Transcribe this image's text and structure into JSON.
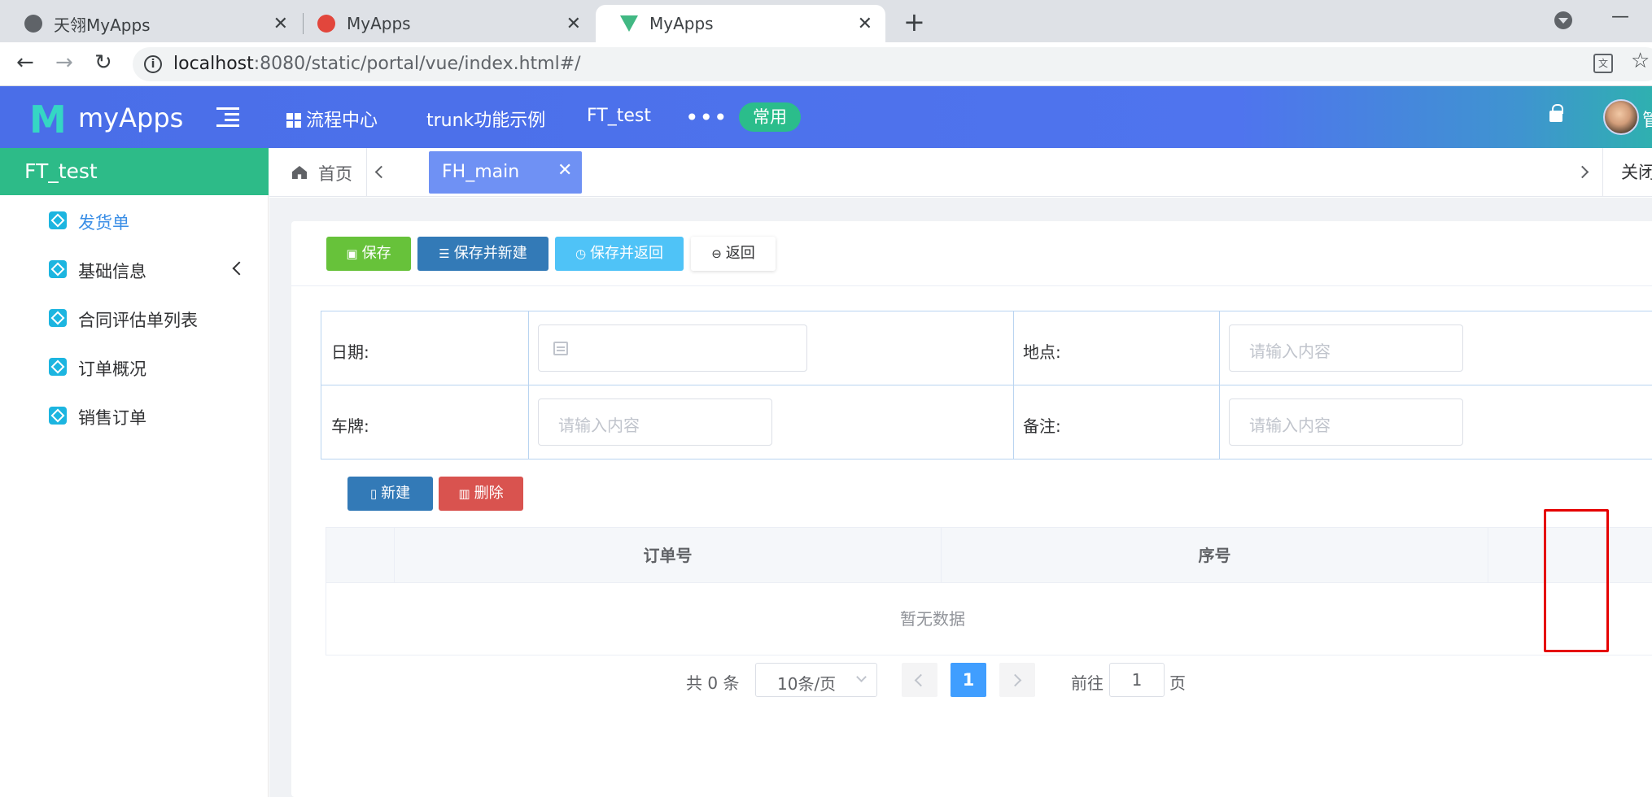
{
  "browser": {
    "tabs": [
      {
        "title": "天翎MyApps",
        "active": false
      },
      {
        "title": "MyApps",
        "active": false
      },
      {
        "title": "MyApps",
        "active": true
      }
    ],
    "url_host": "localhost",
    "url_rest": ":8080/static/portal/vue/index.html#/"
  },
  "header": {
    "logo_mark": "M",
    "logo_text": "myApps",
    "menu": [
      "流程中心",
      "trunk功能示例",
      "FT_test"
    ],
    "favorites_label": "常用",
    "user_initial": "管"
  },
  "sidebar": {
    "title": "FT_test",
    "items": [
      {
        "label": "发货单",
        "active": true,
        "expandable": false
      },
      {
        "label": "基础信息",
        "active": false,
        "expandable": true
      },
      {
        "label": "合同评估单列表",
        "active": false,
        "expandable": false
      },
      {
        "label": "订单概况",
        "active": false,
        "expandable": false
      },
      {
        "label": "销售订单",
        "active": false,
        "expandable": false
      }
    ]
  },
  "tabstrip": {
    "home_label": "首页",
    "active_tab": "FH_main",
    "close_all_label": "关闭"
  },
  "toolbar": {
    "save": "保存",
    "save_new": "保存并新建",
    "save_back": "保存并返回",
    "back": "返回"
  },
  "form": {
    "date_label": "日期:",
    "location_label": "地点:",
    "plate_label": "车牌:",
    "remark_label": "备注:",
    "placeholder": "请输入内容"
  },
  "subgrid": {
    "new_button": "新建",
    "delete_button": "删除",
    "columns": [
      "订单号",
      "序号"
    ],
    "empty_text": "暂无数据"
  },
  "pagination": {
    "total_text": "共 0 条",
    "page_size": "10条/页",
    "current_page": "1",
    "goto_label": "前往",
    "goto_value": "1",
    "page_suffix": "页"
  },
  "colors": {
    "header_blue": "#4f74ee",
    "sidebar_green": "#2dbb88",
    "highlight_red": "#e50000"
  }
}
